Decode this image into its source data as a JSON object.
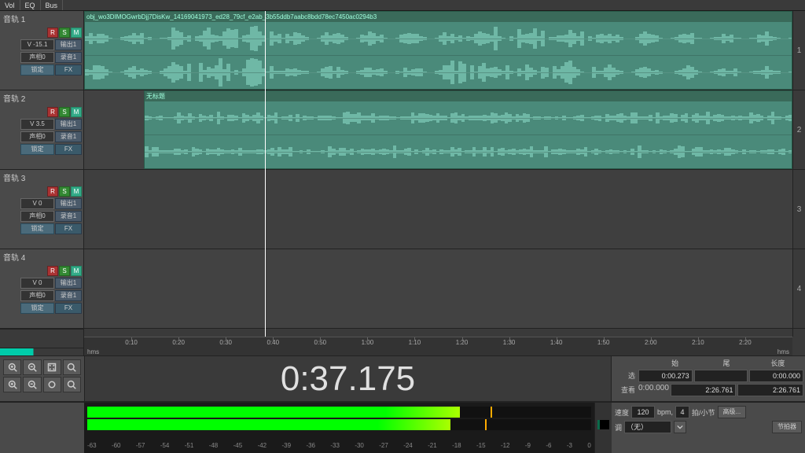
{
  "top_tabs": [
    "Vol",
    "EQ",
    "Bus"
  ],
  "tracks": [
    {
      "title": "音轨 1",
      "vol": "V -15.1",
      "out": "输出1",
      "pan": "声相0",
      "read": "录音1",
      "lock": "锁定",
      "fx": "FX",
      "r": "R",
      "s": "S",
      "m": "M"
    },
    {
      "title": "音轨 2",
      "vol": "V 3.5",
      "out": "输出1",
      "pan": "声相0",
      "read": "录音1",
      "lock": "锁定",
      "fx": "FX",
      "r": "R",
      "s": "S",
      "m": "M"
    },
    {
      "title": "音轨 3",
      "vol": "V 0",
      "out": "输出1",
      "pan": "声相0",
      "read": "录音1",
      "lock": "锁定",
      "fx": "FX",
      "r": "R",
      "s": "S",
      "m": "M"
    },
    {
      "title": "音轨 4",
      "vol": "V 0",
      "out": "输出1",
      "pan": "声相0",
      "read": "录音1",
      "lock": "锁定",
      "fx": "FX",
      "r": "R",
      "s": "S",
      "m": "M"
    }
  ],
  "track_numbers": [
    "1",
    "2",
    "3",
    "4"
  ],
  "clips": {
    "clip1_name": "obj_wo3DIMOGwrbDjj7DisKw_14169041973_ed28_79cf_e2ab_3b55ddb7aabc8bdd78ec7450ac0294b3",
    "clip2_name": "无标题"
  },
  "ruler": {
    "unit": "hms",
    "marks": [
      "0:10",
      "0:20",
      "0:30",
      "0:40",
      "0:50",
      "1:00",
      "1:10",
      "1:20",
      "1:30",
      "1:40",
      "1:50",
      "2:00",
      "2:10",
      "2:20"
    ]
  },
  "big_time": "0:37.175",
  "info": {
    "header_begin": "始",
    "header_end": "尾",
    "header_length": "长度",
    "sel_label": "选",
    "sel_begin": "0:00.273",
    "sel_end": "",
    "sel_length": "0:00.000",
    "view_label": "查看",
    "view_begin": "0:00.000",
    "view_end": "2:26.761",
    "view_length": "2:26.761"
  },
  "meter_scale": [
    "-63",
    "-60",
    "-57",
    "-54",
    "-51",
    "-48",
    "-45",
    "-42",
    "-39",
    "-36",
    "-33",
    "-30",
    "-27",
    "-24",
    "-21",
    "-18",
    "-15",
    "-12",
    "-9",
    "-6",
    "-3",
    "0"
  ],
  "tempo": {
    "label": "速度",
    "value": "120",
    "unit": "bpm,",
    "beats": "4",
    "beats_label": "拍/小节",
    "advanced": "高级...",
    "key_label": "调",
    "key_value": "（无）",
    "metronome": "节拍器"
  }
}
